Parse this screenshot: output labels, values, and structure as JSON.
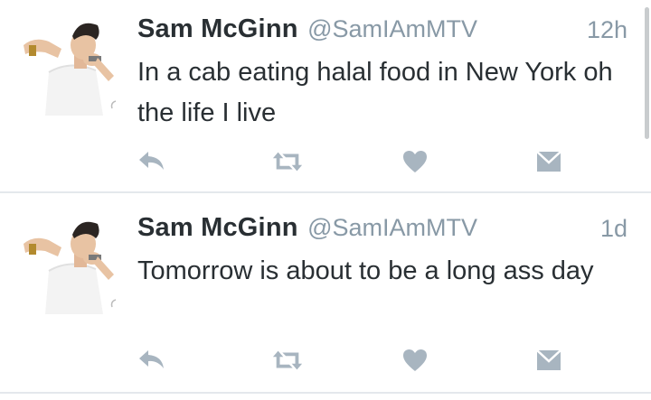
{
  "tweets": [
    {
      "display_name": "Sam McGinn",
      "handle": "@SamIAmMTV",
      "time": "12h",
      "text": "In a cab eating halal food in New York oh the life I live"
    },
    {
      "display_name": "Sam McGinn",
      "handle": "@SamIAmMTV",
      "time": "1d",
      "text": "Tomorrow is about to be a long ass day"
    }
  ],
  "icons": {
    "reply": "reply-icon",
    "retweet": "retweet-icon",
    "like": "heart-icon",
    "dm": "direct-message-icon"
  },
  "colors": {
    "text": "#292f33",
    "secondary": "#8899a6",
    "action_icon": "#a8b5c0",
    "divider": "#e4e8ec"
  }
}
